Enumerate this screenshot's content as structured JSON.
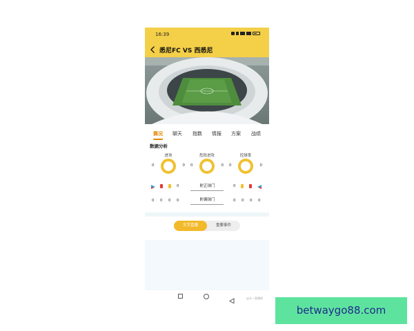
{
  "status_bar": {
    "time": "16:39"
  },
  "header": {
    "title": "悉尼FC VS 西悉尼",
    "accent_color": "#f4cf48"
  },
  "tabs": [
    {
      "label": "赛况",
      "active": true
    },
    {
      "label": "聊天",
      "active": false
    },
    {
      "label": "指数",
      "active": false
    },
    {
      "label": "情报",
      "active": false
    },
    {
      "label": "方案",
      "active": false
    },
    {
      "label": "战绩",
      "active": false
    }
  ],
  "analysis": {
    "title": "数据分析",
    "stats": [
      {
        "label": "进攻",
        "home": "0",
        "away": "0"
      },
      {
        "label": "危险进攻",
        "home": "0",
        "away": "0"
      },
      {
        "label": "控球率",
        "home": "0",
        "away": "0"
      }
    ],
    "home_corners": "0",
    "away_corners": "0",
    "shots_on_target_label": "射正球门",
    "shots_off_target_label": "射偏球门",
    "home_row": [
      "0",
      "0",
      "0",
      "0"
    ],
    "away_row": [
      "0",
      "0",
      "0",
      "0"
    ]
  },
  "pills": {
    "live_text": "文字直播",
    "key_events": "重要事件"
  },
  "nav_watermark": "@头一直播吧",
  "site_watermark": "betwaygo88.com"
}
